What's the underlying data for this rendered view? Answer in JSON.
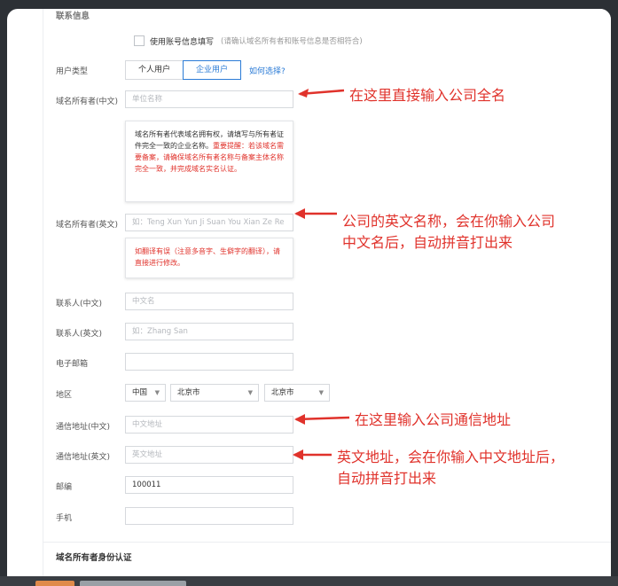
{
  "section_top": "联系信息",
  "use_account_info": {
    "label": "使用账号信息填写",
    "hint": "(请确认域名所有者和账号信息是否相符合)"
  },
  "user_type": {
    "label": "用户类型",
    "options": [
      "个人用户",
      "企业用户"
    ],
    "selected": "企业用户",
    "help_link": "如何选择?"
  },
  "fields": {
    "owner_cn": {
      "label": "域名所有者(中文)",
      "placeholder": "单位名称"
    },
    "owner_cn_tip": {
      "normal": "域名所有者代表域名拥有权，请填写与所有者证件完全一致的企业名称。",
      "red": "重要提醒：若该域名需要备案，请确保域名所有者名称与备案主体名称完全一致，并完成域名实名认证。"
    },
    "owner_en": {
      "label": "域名所有者(英文)",
      "placeholder": "如：Teng Xun Yun Ji Suan You Xian Ze Re"
    },
    "owner_en_tip": {
      "red": "如翻译有误（注意多音字、生僻字的翻译），请直接进行修改。"
    },
    "contact_cn": {
      "label": "联系人(中文)",
      "placeholder": "中文名"
    },
    "contact_en": {
      "label": "联系人(英文)",
      "placeholder": "如：Zhang San"
    },
    "email": {
      "label": "电子邮箱",
      "value": ""
    },
    "region": {
      "label": "地区",
      "country": "中国",
      "province": "北京市",
      "city": "北京市"
    },
    "addr_cn": {
      "label": "通信地址(中文)",
      "placeholder": "中文地址"
    },
    "addr_en": {
      "label": "通信地址(英文)",
      "placeholder": "英文地址"
    },
    "postcode": {
      "label": "邮编",
      "value": "100011"
    },
    "phone": {
      "label": "手机",
      "value": ""
    }
  },
  "section_bottom": "域名所有者身份认证",
  "annotations": {
    "a1": "在这里直接输入公司全名",
    "a2_line1": "公司的英文名称，会在你输入公司",
    "a2_line2": "中文名后，自动拼音打出来",
    "a3": "在这里输入公司通信地址",
    "a4_line1": "英文地址，会在你输入中文地址后，",
    "a4_line2": "自动拼音打出来"
  },
  "colors": {
    "annotation": "#e0322b",
    "accent": "#2b7bd6"
  }
}
